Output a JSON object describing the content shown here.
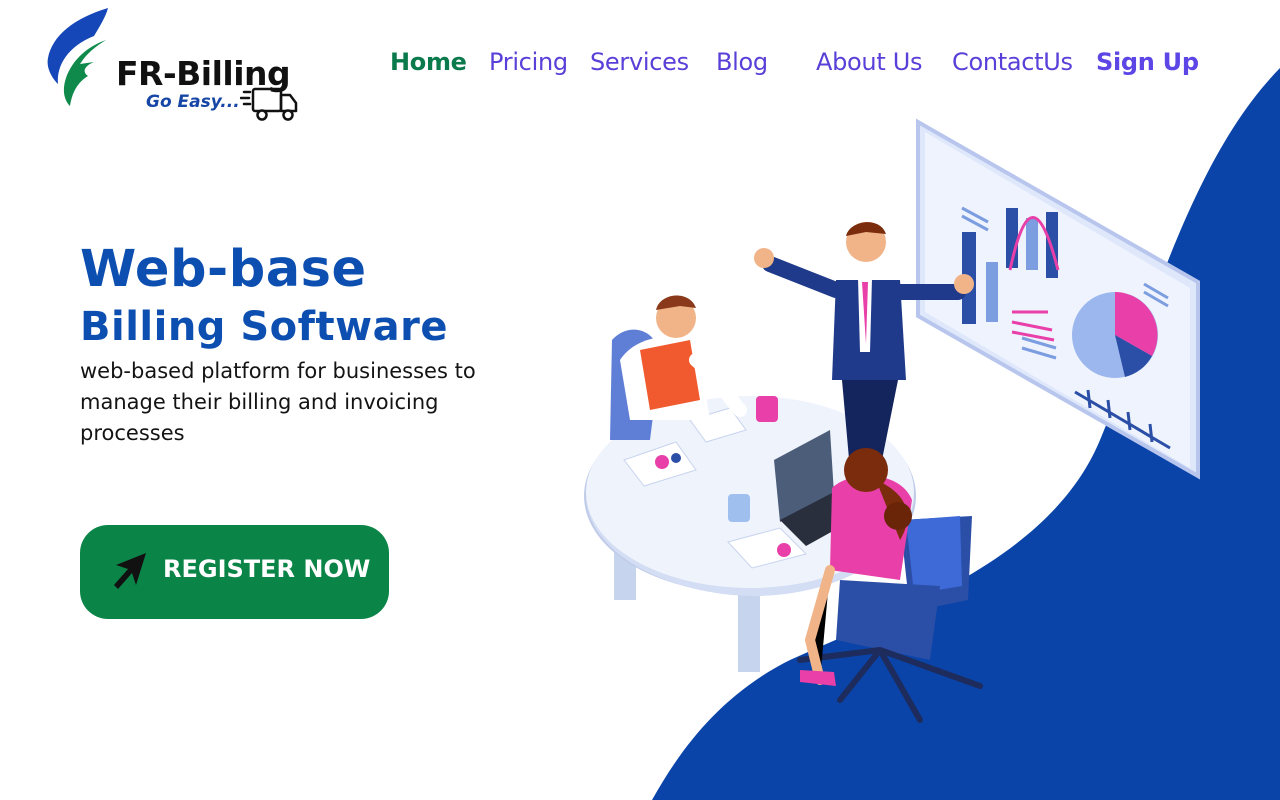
{
  "brand": {
    "name": "FR-Billing",
    "tagline": "Go Easy...",
    "logo_icon": "fr-leaf-logo",
    "truck_icon": "delivery-truck-icon"
  },
  "nav": {
    "items": [
      {
        "label": "Home",
        "active": true
      },
      {
        "label": "Pricing"
      },
      {
        "label": "Services"
      },
      {
        "label": "Blog"
      },
      {
        "label": "About Us"
      },
      {
        "label": "ContactUs"
      }
    ],
    "signup_label": "Sign Up"
  },
  "hero": {
    "title_line1": "Web-base",
    "title_line2": "Billing Software",
    "description": "web-based platform for businesses to manage their billing and invoicing processes",
    "cta_label": "REGISTER NOW",
    "cta_icon": "cursor-arrow-icon"
  },
  "colors": {
    "primary_blue": "#0c4fb0",
    "cta_green": "#0b8448",
    "nav_active": "#0a7a4c",
    "nav_text": "#5a40d8",
    "shape_blue": "#0a44a8"
  }
}
